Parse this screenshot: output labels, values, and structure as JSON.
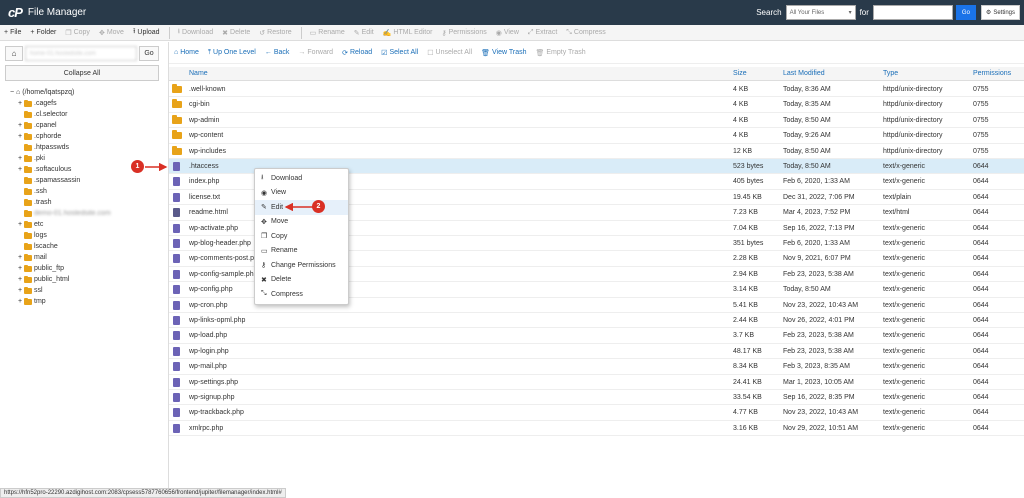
{
  "header": {
    "logo_text": "cP",
    "title": "File Manager",
    "search_label": "Search",
    "search_scope": "All Your Files",
    "for_label": "for",
    "search_value": "",
    "go_label": "Go",
    "settings_label": "Settings"
  },
  "toolbar": {
    "items": [
      {
        "label": "File",
        "icon": "plus-icon",
        "enabled": true
      },
      {
        "label": "Folder",
        "icon": "plus-icon",
        "enabled": true
      },
      {
        "label": "Copy",
        "icon": "copy-icon",
        "enabled": false
      },
      {
        "label": "Move",
        "icon": "move-icon",
        "enabled": false
      },
      {
        "label": "Upload",
        "icon": "upload-icon",
        "enabled": true
      },
      {
        "label": "Download",
        "icon": "download-icon",
        "enabled": false
      },
      {
        "label": "Delete",
        "icon": "delete-icon",
        "enabled": false
      },
      {
        "label": "Restore",
        "icon": "restore-icon",
        "enabled": false
      },
      {
        "label": "Rename",
        "icon": "rename-icon",
        "enabled": false
      },
      {
        "label": "Edit",
        "icon": "pencil-icon",
        "enabled": false
      },
      {
        "label": "HTML Editor",
        "icon": "html-editor-icon",
        "enabled": false
      },
      {
        "label": "Permissions",
        "icon": "key-icon",
        "enabled": false
      },
      {
        "label": "View",
        "icon": "eye-icon",
        "enabled": false
      },
      {
        "label": "Extract",
        "icon": "extract-icon",
        "enabled": false
      },
      {
        "label": "Compress",
        "icon": "compress-icon",
        "enabled": false
      }
    ]
  },
  "sidebar": {
    "path_value": "home-01.hostedsite.com",
    "go_label": "Go",
    "collapse_label": "Collapse All",
    "root_label": "(/home/lqatspzq)",
    "tree": [
      {
        "label": ".cagefs",
        "toggle": "+",
        "indent": 1
      },
      {
        "label": ".cl.selector",
        "toggle": "",
        "indent": 1
      },
      {
        "label": ".cpanel",
        "toggle": "+",
        "indent": 1
      },
      {
        "label": ".cphorde",
        "toggle": "+",
        "indent": 1
      },
      {
        "label": ".htpasswds",
        "toggle": "",
        "indent": 1
      },
      {
        "label": ".pki",
        "toggle": "+",
        "indent": 1
      },
      {
        "label": ".softaculous",
        "toggle": "+",
        "indent": 1
      },
      {
        "label": ".spamassassin",
        "toggle": "",
        "indent": 1
      },
      {
        "label": ".ssh",
        "toggle": "",
        "indent": 1
      },
      {
        "label": ".trash",
        "toggle": "",
        "indent": 1
      },
      {
        "label": "demo-01.hostedsite.com",
        "toggle": "",
        "indent": 1,
        "blurred": true
      },
      {
        "label": "etc",
        "toggle": "+",
        "indent": 1
      },
      {
        "label": "logs",
        "toggle": "",
        "indent": 1
      },
      {
        "label": "lscache",
        "toggle": "",
        "indent": 1
      },
      {
        "label": "mail",
        "toggle": "+",
        "indent": 1
      },
      {
        "label": "public_ftp",
        "toggle": "+",
        "indent": 1
      },
      {
        "label": "public_html",
        "toggle": "+",
        "indent": 1
      },
      {
        "label": "ssl",
        "toggle": "+",
        "indent": 1
      },
      {
        "label": "tmp",
        "toggle": "+",
        "indent": 1
      }
    ]
  },
  "navbar": {
    "items": [
      {
        "label": "Home",
        "icon": "home-icon",
        "enabled": true
      },
      {
        "label": "Up One Level",
        "icon": "level-up-icon",
        "enabled": true
      },
      {
        "label": "Back",
        "icon": "back-arrow-icon",
        "enabled": true
      },
      {
        "label": "Forward",
        "icon": "forward-arrow-icon",
        "enabled": false
      },
      {
        "label": "Reload",
        "icon": "reload-icon",
        "enabled": true
      },
      {
        "label": "Select All",
        "icon": "checkbox-checked-icon",
        "enabled": true
      },
      {
        "label": "Unselect All",
        "icon": "checkbox-empty-icon",
        "enabled": false
      },
      {
        "label": "View Trash",
        "icon": "trash-icon",
        "enabled": true
      },
      {
        "label": "Empty Trash",
        "icon": "trash-icon",
        "enabled": false
      }
    ]
  },
  "table": {
    "columns": [
      "Name",
      "Size",
      "Last Modified",
      "Type",
      "Permissions"
    ],
    "rows": [
      {
        "name": ".well-known",
        "size": "4 KB",
        "modified": "Today, 8:36 AM",
        "type": "httpd/unix-directory",
        "perms": "0755",
        "kind": "folder"
      },
      {
        "name": "cgi-bin",
        "size": "4 KB",
        "modified": "Today, 8:35 AM",
        "type": "httpd/unix-directory",
        "perms": "0755",
        "kind": "folder"
      },
      {
        "name": "wp-admin",
        "size": "4 KB",
        "modified": "Today, 8:50 AM",
        "type": "httpd/unix-directory",
        "perms": "0755",
        "kind": "folder"
      },
      {
        "name": "wp-content",
        "size": "4 KB",
        "modified": "Today, 9:26 AM",
        "type": "httpd/unix-directory",
        "perms": "0755",
        "kind": "folder"
      },
      {
        "name": "wp-includes",
        "size": "12 KB",
        "modified": "Today, 8:50 AM",
        "type": "httpd/unix-directory",
        "perms": "0755",
        "kind": "folder"
      },
      {
        "name": ".htaccess",
        "size": "523 bytes",
        "modified": "Today, 8:50 AM",
        "type": "text/x-generic",
        "perms": "0644",
        "kind": "file",
        "selected": true
      },
      {
        "name": "index.php",
        "size": "405 bytes",
        "modified": "Feb 6, 2020, 1:33 AM",
        "type": "text/x-generic",
        "perms": "0644",
        "kind": "file"
      },
      {
        "name": "license.txt",
        "size": "19.45 KB",
        "modified": "Dec 31, 2022, 7:06 PM",
        "type": "text/plain",
        "perms": "0644",
        "kind": "file"
      },
      {
        "name": "readme.html",
        "size": "7.23 KB",
        "modified": "Mar 4, 2023, 7:52 PM",
        "type": "text/html",
        "perms": "0644",
        "kind": "html"
      },
      {
        "name": "wp-activate.php",
        "size": "7.04 KB",
        "modified": "Sep 16, 2022, 7:13 PM",
        "type": "text/x-generic",
        "perms": "0644",
        "kind": "file"
      },
      {
        "name": "wp-blog-header.php",
        "size": "351 bytes",
        "modified": "Feb 6, 2020, 1:33 AM",
        "type": "text/x-generic",
        "perms": "0644",
        "kind": "file"
      },
      {
        "name": "wp-comments-post.php",
        "size": "2.28 KB",
        "modified": "Nov 9, 2021, 6:07 PM",
        "type": "text/x-generic",
        "perms": "0644",
        "kind": "file"
      },
      {
        "name": "wp-config-sample.php",
        "size": "2.94 KB",
        "modified": "Feb 23, 2023, 5:38 AM",
        "type": "text/x-generic",
        "perms": "0644",
        "kind": "file"
      },
      {
        "name": "wp-config.php",
        "size": "3.14 KB",
        "modified": "Today, 8:50 AM",
        "type": "text/x-generic",
        "perms": "0644",
        "kind": "file"
      },
      {
        "name": "wp-cron.php",
        "size": "5.41 KB",
        "modified": "Nov 23, 2022, 10:43 AM",
        "type": "text/x-generic",
        "perms": "0644",
        "kind": "file"
      },
      {
        "name": "wp-links-opml.php",
        "size": "2.44 KB",
        "modified": "Nov 26, 2022, 4:01 PM",
        "type": "text/x-generic",
        "perms": "0644",
        "kind": "file"
      },
      {
        "name": "wp-load.php",
        "size": "3.7 KB",
        "modified": "Feb 23, 2023, 5:38 AM",
        "type": "text/x-generic",
        "perms": "0644",
        "kind": "file"
      },
      {
        "name": "wp-login.php",
        "size": "48.17 KB",
        "modified": "Feb 23, 2023, 5:38 AM",
        "type": "text/x-generic",
        "perms": "0644",
        "kind": "file"
      },
      {
        "name": "wp-mail.php",
        "size": "8.34 KB",
        "modified": "Feb 3, 2023, 8:35 AM",
        "type": "text/x-generic",
        "perms": "0644",
        "kind": "file"
      },
      {
        "name": "wp-settings.php",
        "size": "24.41 KB",
        "modified": "Mar 1, 2023, 10:05 AM",
        "type": "text/x-generic",
        "perms": "0644",
        "kind": "file"
      },
      {
        "name": "wp-signup.php",
        "size": "33.54 KB",
        "modified": "Sep 16, 2022, 8:35 PM",
        "type": "text/x-generic",
        "perms": "0644",
        "kind": "file"
      },
      {
        "name": "wp-trackback.php",
        "size": "4.77 KB",
        "modified": "Nov 23, 2022, 10:43 AM",
        "type": "text/x-generic",
        "perms": "0644",
        "kind": "file"
      },
      {
        "name": "xmlrpc.php",
        "size": "3.16 KB",
        "modified": "Nov 29, 2022, 10:51 AM",
        "type": "text/x-generic",
        "perms": "0644",
        "kind": "file"
      }
    ]
  },
  "context_menu": {
    "items": [
      {
        "label": "Download",
        "icon": "download-icon"
      },
      {
        "label": "View",
        "icon": "eye-icon"
      },
      {
        "label": "Edit",
        "icon": "pencil-icon",
        "hover": true
      },
      {
        "label": "Move",
        "icon": "move-icon"
      },
      {
        "label": "Copy",
        "icon": "copy-icon"
      },
      {
        "label": "Rename",
        "icon": "rename-icon"
      },
      {
        "label": "Change Permissions",
        "icon": "key-icon"
      },
      {
        "label": "Delete",
        "icon": "delete-icon"
      },
      {
        "label": "Compress",
        "icon": "compress-icon"
      }
    ]
  },
  "annotations": {
    "badge_1": "1",
    "badge_2": "2",
    "color": "#d93025"
  },
  "status_bar": {
    "url": "https://hfn52pro-22290.azdigihost.com:2083/cpsess5787760656/frontend/jupiter/filemanager/index.html#"
  },
  "colors": {
    "topbar": "#293a4a",
    "link": "#1a6eb8",
    "folder": "#e8a319",
    "file": "#6c63b6",
    "selected_row": "#d9ecf8"
  }
}
